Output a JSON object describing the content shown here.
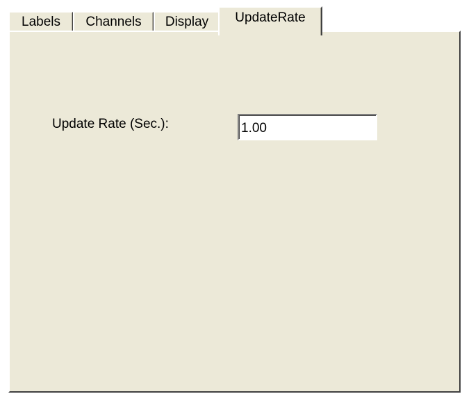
{
  "tabs": [
    {
      "label": "Labels",
      "selected": false
    },
    {
      "label": "Channels",
      "selected": false
    },
    {
      "label": "Display",
      "selected": false
    },
    {
      "label": "UpdateRate",
      "selected": true
    }
  ],
  "update_rate": {
    "label": "Update Rate (Sec.):",
    "value": "1.00"
  },
  "colors": {
    "panel_background": "#ece9d8",
    "input_background": "#ffffff",
    "text": "#000000"
  }
}
